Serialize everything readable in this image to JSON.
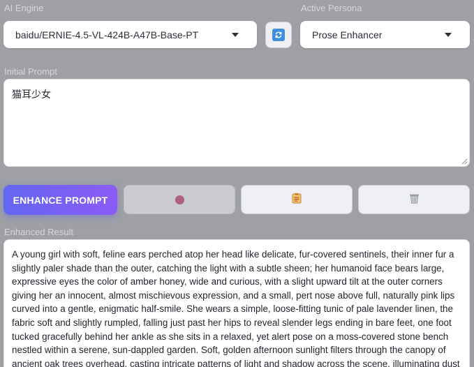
{
  "engine": {
    "label": "AI Engine",
    "selected": "baidu/ERNIE-4.5-VL-424B-A47B-Base-PT"
  },
  "persona": {
    "label": "Active Persona",
    "selected": "Prose Enhancer"
  },
  "refresh": {
    "icon": "refresh-icon",
    "icon_color": "#3f8fdc"
  },
  "prompt": {
    "label": "Initial Prompt",
    "value": "猫耳少女"
  },
  "actions": {
    "enhance_label": "ENHANCE PROMPT",
    "enhance_gradient": [
      "#6366f1",
      "#8b5cf6"
    ],
    "record_icon": "record-icon",
    "record_color": "#b0607a",
    "clipboard_icon": "clipboard-icon",
    "trash_icon": "trash-icon"
  },
  "result": {
    "label": "Enhanced Result",
    "value": "A young girl with soft, feline ears perched atop her head like delicate, fur-covered sentinels, their inner fur a slightly paler shade than the outer, catching the light with a subtle sheen; her humanoid face bears large, expressive eyes the color of amber honey, wide and curious, with a slight upward tilt at the outer corners giving her an innocent, almost mischievous expression, and a small, pert nose above full, naturally pink lips curved into a gentle, enigmatic half-smile. She wears a simple, loose-fitting tunic of pale lavender linen, the fabric soft and slightly rumpled, falling just past her hips to reveal slender legs ending in bare feet, one foot tucked gracefully behind her ankle as she sits in a relaxed, yet alert pose on a moss-covered stone bench nestled within a serene, sun-dappled garden. Soft, golden afternoon sunlight filters through the canopy of ancient oak trees overhead, casting intricate patterns of light and shadow across the scene, illuminating dust motes"
  }
}
